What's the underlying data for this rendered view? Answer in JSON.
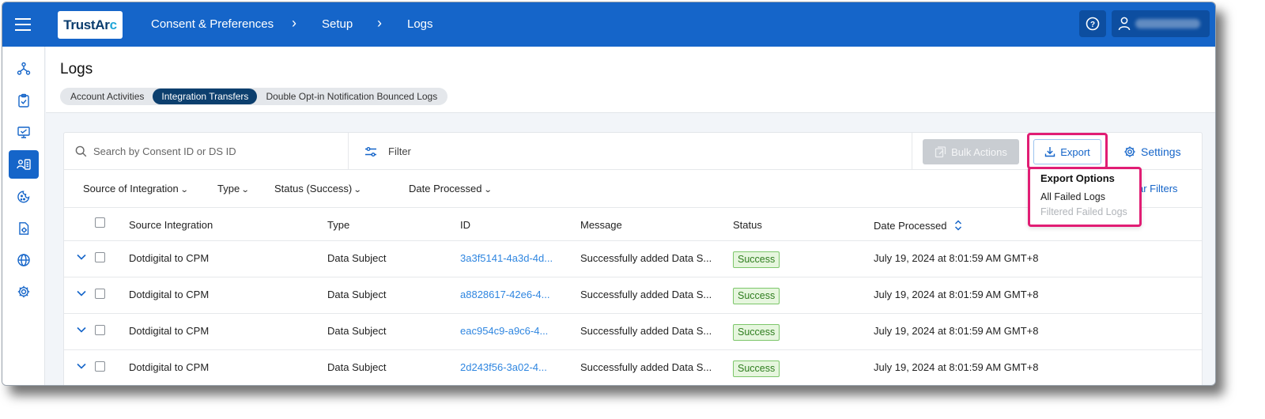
{
  "topbar": {
    "logo_main": "TrustAr",
    "logo_accent": "c",
    "breadcrumb": [
      "Consent & Preferences",
      "Setup",
      "Logs"
    ],
    "breadcrumb_separator": "›",
    "help_icon": "help-circle-icon",
    "user_icon": "user-icon",
    "colors": {
      "background": "#1565c9",
      "button": "#0d4ea0"
    }
  },
  "sidebar": {
    "items": [
      {
        "icon": "network-icon",
        "active": false
      },
      {
        "icon": "clipboard-check-icon",
        "active": false
      },
      {
        "icon": "monitor-icon",
        "active": false
      },
      {
        "icon": "contact-card-icon",
        "active": true
      },
      {
        "icon": "cookie-icon",
        "active": false
      },
      {
        "icon": "document-gear-icon",
        "active": false
      },
      {
        "icon": "globe-icon",
        "active": false
      },
      {
        "icon": "gear-icon",
        "active": false
      }
    ]
  },
  "page": {
    "title": "Logs",
    "tabs": [
      {
        "label": "Account Activities",
        "active": false
      },
      {
        "label": "Integration Transfers",
        "active": true
      },
      {
        "label": "Double Opt-in Notification Bounced Logs",
        "active": false
      }
    ]
  },
  "toolbar": {
    "search_placeholder": "Search by Consent ID or DS ID",
    "filter_label": "Filter",
    "bulk_actions_label": "Bulk Actions",
    "export_label": "Export",
    "settings_label": "Settings"
  },
  "filters": {
    "source": "Source of Integration",
    "type": "Type",
    "status": "Status (Success)",
    "date": "Date Processed",
    "clear": "ar Filters"
  },
  "table": {
    "columns": {
      "source": "Source Integration",
      "type": "Type",
      "id": "ID",
      "message": "Message",
      "status": "Status",
      "date": "Date Processed"
    },
    "rows": [
      {
        "source": "Dotdigital to CPM",
        "type": "Data Subject",
        "id": "3a3f5141-4a3d-4d...",
        "message": "Successfully added Data S...",
        "status": "Success",
        "date": "July 19, 2024 at 8:01:59 AM GMT+8"
      },
      {
        "source": "Dotdigital to CPM",
        "type": "Data Subject",
        "id": "a8828617-42e6-4...",
        "message": "Successfully added Data S...",
        "status": "Success",
        "date": "July 19, 2024 at 8:01:59 AM GMT+8"
      },
      {
        "source": "Dotdigital to CPM",
        "type": "Data Subject",
        "id": "eac954c9-a9c6-4...",
        "message": "Successfully added Data S...",
        "status": "Success",
        "date": "July 19, 2024 at 8:01:59 AM GMT+8"
      },
      {
        "source": "Dotdigital to CPM",
        "type": "Data Subject",
        "id": "2d243f56-3a02-4...",
        "message": "Successfully added Data S...",
        "status": "Success",
        "date": "July 19, 2024 at 8:01:59 AM GMT+8"
      }
    ]
  },
  "export_menu": {
    "title": "Export Options",
    "items": [
      {
        "label": "All Failed Logs",
        "enabled": true
      },
      {
        "label": "Filtered Failed Logs",
        "enabled": false
      }
    ]
  },
  "colors": {
    "highlight": "#e11d74",
    "link": "#2f86e0",
    "success_bg": "#e6f6de",
    "success_text": "#2e7d1e"
  }
}
